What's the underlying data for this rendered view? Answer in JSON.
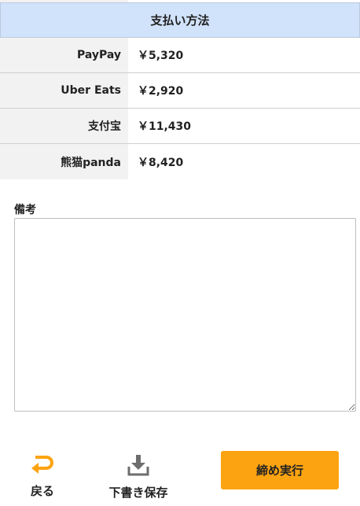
{
  "payment": {
    "header": "支払い方法",
    "rows": [
      {
        "method": "PayPay",
        "amount": "￥5,320"
      },
      {
        "method": "Uber Eats",
        "amount": "￥2,920"
      },
      {
        "method": "支付宝",
        "amount": "￥11,430"
      },
      {
        "method": "熊猫panda",
        "amount": "￥8,420"
      }
    ]
  },
  "memo": {
    "label": "備考",
    "value": ""
  },
  "footer": {
    "back_label": "戻る",
    "draft_label": "下書き保存",
    "execute_label": "締め実行",
    "back_icon": "return-arrow-icon",
    "draft_icon": "download-tray-icon"
  },
  "colors": {
    "accent": "#fca311",
    "header_bg": "#d1e2fb",
    "label_bg": "#f2f2f2"
  }
}
